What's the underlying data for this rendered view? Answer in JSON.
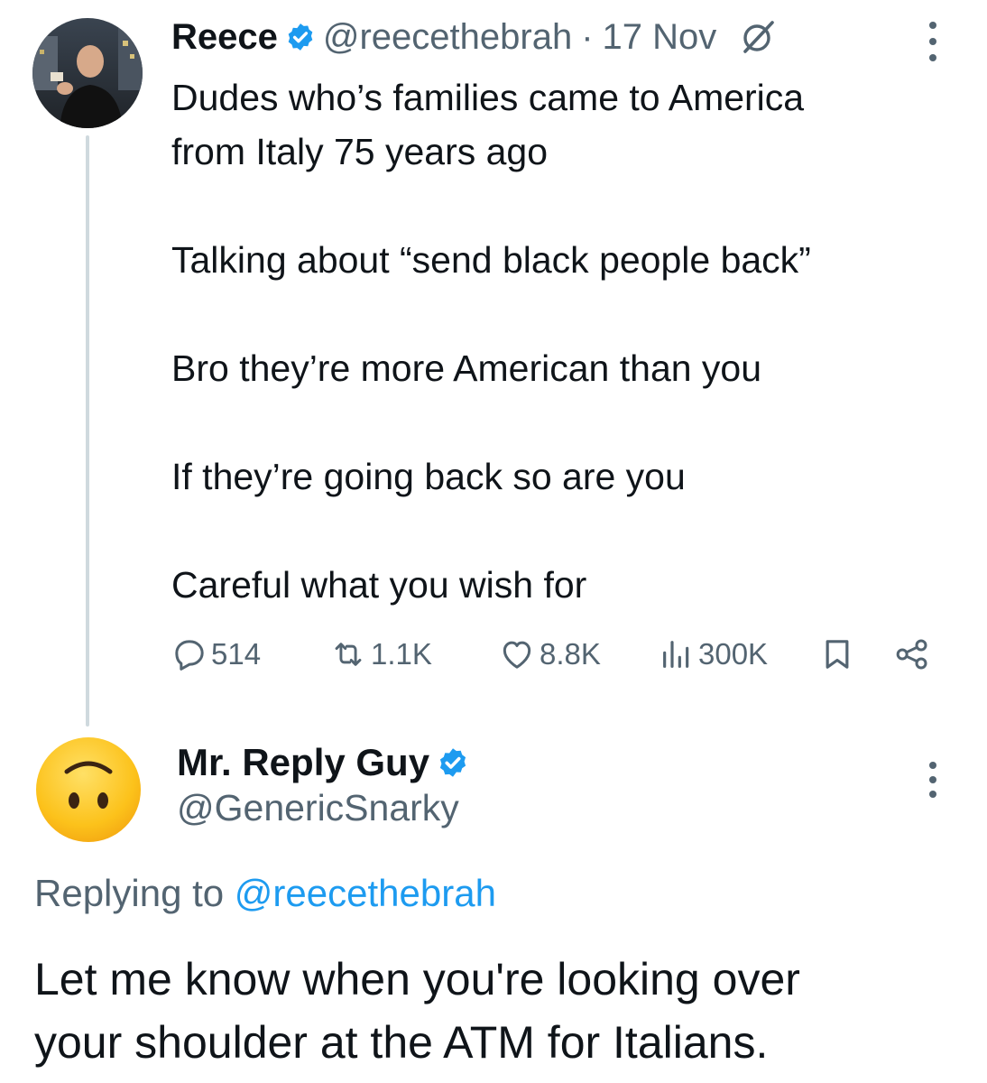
{
  "original_tweet": {
    "author_name": "Reece",
    "author_handle": "@reecethebrah",
    "separator": "·",
    "date": "17 Nov",
    "verified_icon": "verified-badge-icon",
    "lines": [
      "Dudes who’s families came to America",
      "from Italy 75 years ago",
      "",
      "Talking about “send black people back”",
      "",
      "Bro they’re more American than you",
      "",
      "If they’re going back so are you",
      "",
      "Careful what you wish for"
    ],
    "stats": {
      "replies": "514",
      "reposts": "1.1K",
      "likes": "8.8K",
      "views": "300K"
    }
  },
  "reply_tweet": {
    "author_name": "Mr. Reply Guy",
    "author_handle": "@GenericSnarky",
    "avatar_icon": "upside-down-face-emoji",
    "replying_prefix": "Replying to",
    "replying_handle": "@reecethebrah",
    "lines": [
      "Let me know when you're looking over",
      "your shoulder at the ATM for Italians."
    ]
  },
  "colors": {
    "text": "#0f1419",
    "secondary_text": "#536471",
    "accent_blue": "#1d9bf0",
    "thread_line": "#cfd9de"
  }
}
